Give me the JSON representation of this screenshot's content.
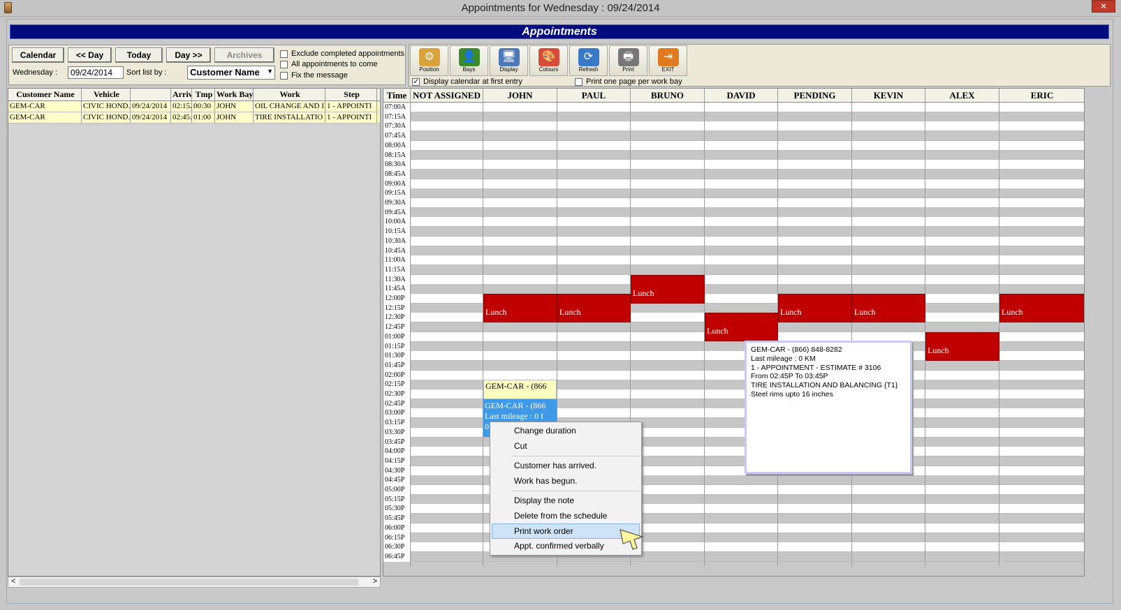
{
  "window": {
    "title": "Appointments for Wednesday : 09/24/2014",
    "close": "✕"
  },
  "banner": "Appointments",
  "nav": {
    "calendar": "Calendar",
    "prev_day": "<< Day",
    "today": "Today",
    "next_day": "Day >>",
    "archives": "Archives"
  },
  "date": {
    "label": "Wednesday :",
    "value": "09/24/2014"
  },
  "sort": {
    "label": "Sort list by :",
    "value": "Customer Name"
  },
  "options": [
    {
      "label": "Exclude completed appointments",
      "checked": false
    },
    {
      "label": "All appointments to come",
      "checked": false
    },
    {
      "label": "Fix the message",
      "checked": false
    }
  ],
  "toolbar": [
    {
      "label": "Position",
      "icon": "position-icon",
      "color": "#d9a23a"
    },
    {
      "label": "Bays",
      "icon": "person-icon",
      "color": "#3b8a2e"
    },
    {
      "label": "Display",
      "icon": "monitor-icon",
      "color": "#4a78b8"
    },
    {
      "label": "Colours",
      "icon": "palette-icon",
      "color": "#d64a3a"
    },
    {
      "label": "Refresh",
      "icon": "refresh-icon",
      "color": "#3a78c8"
    },
    {
      "label": "Print",
      "icon": "printer-icon",
      "color": "#777777"
    },
    {
      "label": "EXIT",
      "icon": "exit-icon",
      "color": "#e07a20"
    }
  ],
  "toolbar_options": [
    {
      "label": "Display calendar at first entry",
      "checked": true
    },
    {
      "label": "Print one page per work bay",
      "checked": false
    }
  ],
  "list": {
    "columns": [
      "Customer Name",
      "Vehicle",
      "",
      "Arriv",
      "Tmp",
      "Work Bay",
      "Work",
      "Step"
    ],
    "rows": [
      [
        "GEM-CAR",
        "CIVIC HOND.",
        "09/24/2014",
        "02:15.",
        "00:30",
        "JOHN",
        "OIL CHANGE AND II",
        "1 - APPOINTI"
      ],
      [
        "GEM-CAR",
        "CIVIC HOND.",
        "09/24/2014",
        "02:45.",
        "01:00",
        "JOHN",
        "TIRE INSTALLATIO",
        "1 - APPOINTI"
      ]
    ]
  },
  "schedule": {
    "time_header": "Time",
    "bays": [
      "NOT ASSIGNED",
      "JOHN",
      "PAUL",
      "BRUNO",
      "DAVID",
      "PENDING",
      "KEVIN",
      "ALEX",
      "ERIC"
    ],
    "times": [
      "07:00A",
      "07:15A",
      "07:30A",
      "07:45A",
      "08:00A",
      "08:15A",
      "08:30A",
      "08:45A",
      "09:00A",
      "09:15A",
      "09:30A",
      "09:45A",
      "10:00A",
      "10:15A",
      "10:30A",
      "10:45A",
      "11:00A",
      "11:15A",
      "11:30A",
      "11:45A",
      "12:00P",
      "12:15P",
      "12:30P",
      "12:45P",
      "01:00P",
      "01:15P",
      "01:30P",
      "01:45P",
      "02:00P",
      "02:15P",
      "02:30P",
      "02:45P",
      "03:00P",
      "03:15P",
      "03:30P",
      "03:45P",
      "04:00P",
      "04:15P",
      "04:30P",
      "04:45P",
      "05:00P",
      "05:15P",
      "05:30P",
      "05:45P",
      "06:00P",
      "06:15P",
      "06:30P",
      "06:45P"
    ],
    "lunch_label": "Lunch",
    "lunches": [
      {
        "bay": "JOHN",
        "start": "12:00P",
        "end": "12:30P"
      },
      {
        "bay": "PAUL",
        "start": "12:00P",
        "end": "12:30P"
      },
      {
        "bay": "BRUNO",
        "start": "11:30A",
        "end": "12:00P"
      },
      {
        "bay": "DAVID",
        "start": "12:30P",
        "end": "01:00P"
      },
      {
        "bay": "PENDING",
        "start": "12:00P",
        "end": "12:30P"
      },
      {
        "bay": "KEVIN",
        "start": "12:00P",
        "end": "12:30P"
      },
      {
        "bay": "ALEX",
        "start": "01:00P",
        "end": "01:30P"
      },
      {
        "bay": "ERIC",
        "start": "12:00P",
        "end": "12:30P"
      }
    ],
    "appointments": [
      {
        "bay": "JOHN",
        "start": "02:15P",
        "lines": [
          "GEM-CAR - (866"
        ]
      },
      {
        "bay": "JOHN",
        "start": "02:45P",
        "lines": [
          "GEM-CAR - (866",
          "Last mileage : 0 I",
          "0"
        ]
      }
    ]
  },
  "tooltip": {
    "lines": [
      "GEM-CAR - (866) 848-8282",
      "Last mileage : 0 KM",
      "1 - APPOINTMENT - ESTIMATE  # 3106",
      "From 02:45P To 03:45P",
      "TIRE INSTALLATION AND BALANCING {T1}",
      "Steel rims upto 16 inches"
    ]
  },
  "context_menu": {
    "groups": [
      [
        "Change duration",
        "Cut"
      ],
      [
        "Customer has arrived.",
        "Work has begun."
      ],
      [
        "Display the note",
        "Delete from the schedule",
        "Print work order",
        "Appt. confirmed verbally"
      ]
    ],
    "highlighted": "Print work order"
  },
  "scroll": {
    "left": "<",
    "right": ">"
  }
}
